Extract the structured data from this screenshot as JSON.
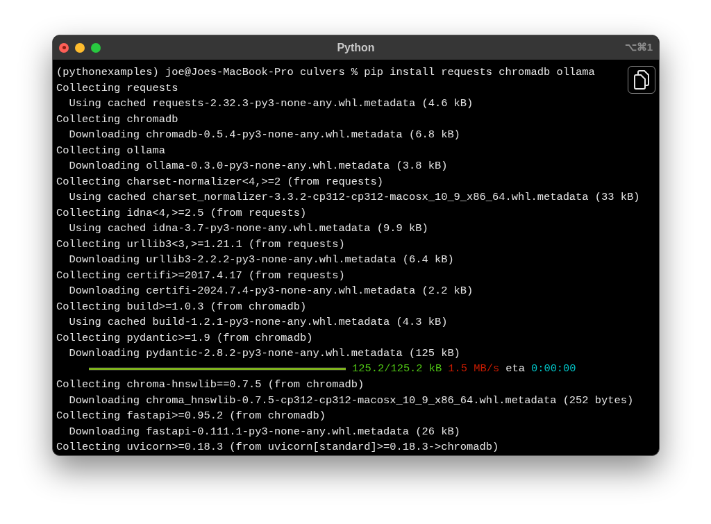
{
  "window": {
    "title": "Python",
    "shortcut": "⌥⌘1"
  },
  "lines": [
    {
      "kind": "text",
      "text": "(pythonexamples) joe@Joes-MacBook-Pro culvers % pip install requests chromadb ollama"
    },
    {
      "kind": "text",
      "text": "Collecting requests"
    },
    {
      "kind": "text",
      "text": "  Using cached requests-2.32.3-py3-none-any.whl.metadata (4.6 kB)"
    },
    {
      "kind": "text",
      "text": "Collecting chromadb"
    },
    {
      "kind": "text",
      "text": "  Downloading chromadb-0.5.4-py3-none-any.whl.metadata (6.8 kB)"
    },
    {
      "kind": "text",
      "text": "Collecting ollama"
    },
    {
      "kind": "text",
      "text": "  Downloading ollama-0.3.0-py3-none-any.whl.metadata (3.8 kB)"
    },
    {
      "kind": "text",
      "text": "Collecting charset-normalizer<4,>=2 (from requests)"
    },
    {
      "kind": "text",
      "text": "  Using cached charset_normalizer-3.3.2-cp312-cp312-macosx_10_9_x86_64.whl.metadata (33 kB)"
    },
    {
      "kind": "text",
      "text": "Collecting idna<4,>=2.5 (from requests)"
    },
    {
      "kind": "text",
      "text": "  Using cached idna-3.7-py3-none-any.whl.metadata (9.9 kB)"
    },
    {
      "kind": "text",
      "text": "Collecting urllib3<3,>=1.21.1 (from requests)"
    },
    {
      "kind": "text",
      "text": "  Downloading urllib3-2.2.2-py3-none-any.whl.metadata (6.4 kB)"
    },
    {
      "kind": "text",
      "text": "Collecting certifi>=2017.4.17 (from requests)"
    },
    {
      "kind": "text",
      "text": "  Downloading certifi-2024.7.4-py3-none-any.whl.metadata (2.2 kB)"
    },
    {
      "kind": "text",
      "text": "Collecting build>=1.0.3 (from chromadb)"
    },
    {
      "kind": "text",
      "text": "  Using cached build-1.2.1-py3-none-any.whl.metadata (4.3 kB)"
    },
    {
      "kind": "text",
      "text": "Collecting pydantic>=1.9 (from chromadb)"
    },
    {
      "kind": "text",
      "text": "  Downloading pydantic-2.8.2-py3-none-any.whl.metadata (125 kB)"
    },
    {
      "kind": "progress",
      "level": 1,
      "segments": [
        {
          "text": "125.2/125.2 kB",
          "color": "#4fc414"
        },
        {
          "text": "1.5 MB/s",
          "color": "#c91b00"
        },
        {
          "text": "eta",
          "color": "#e5e5e5"
        },
        {
          "text": "0:00:00",
          "color": "#00c5c7"
        }
      ]
    },
    {
      "kind": "text",
      "text": "Collecting chroma-hnswlib==0.7.5 (from chromadb)"
    },
    {
      "kind": "text",
      "text": "  Downloading chroma_hnswlib-0.7.5-cp312-cp312-macosx_10_9_x86_64.whl.metadata (252 bytes)"
    },
    {
      "kind": "text",
      "text": "Collecting fastapi>=0.95.2 (from chromadb)"
    },
    {
      "kind": "text",
      "text": "  Downloading fastapi-0.111.1-py3-none-any.whl.metadata (26 kB)"
    },
    {
      "kind": "text",
      "text": "Collecting uvicorn>=0.18.3 (from uvicorn[standard]>=0.18.3->chromadb)"
    }
  ]
}
